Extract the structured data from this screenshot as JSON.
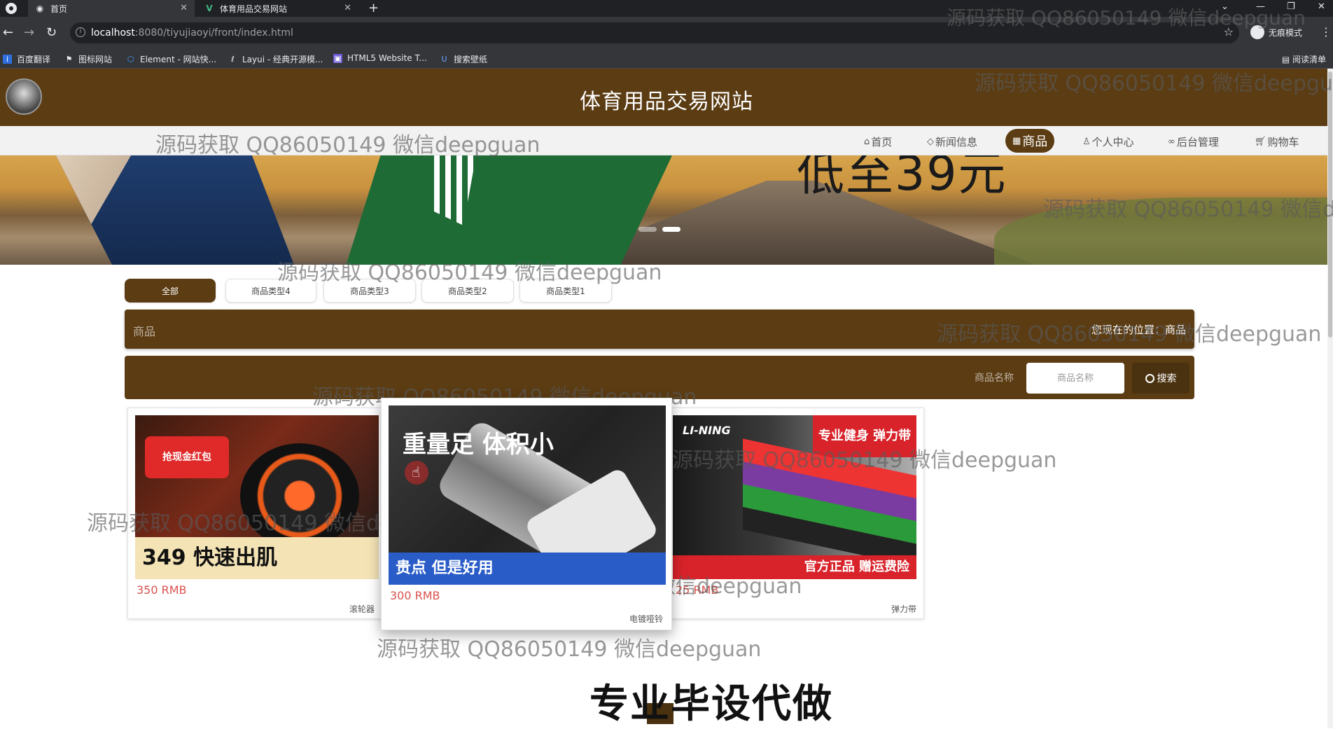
{
  "browser": {
    "tabs": [
      {
        "title": "首页",
        "active": true
      },
      {
        "title": "体育用品交易网站",
        "active": false
      }
    ],
    "url_host": "localhost",
    "url_path": ":8080/tiyujiaoyi/front/index.html",
    "profile_label": "无痕模式",
    "bookmarks": [
      "百度翻译",
      "图标网站",
      "Element - 网站快...",
      "Layui - 经典开源模...",
      "HTML5 Website T...",
      "搜索壁纸"
    ],
    "reading_list": "阅读清单"
  },
  "site": {
    "title": "体育用品交易网站",
    "nav": [
      {
        "label": "首页",
        "icon": "home-icon"
      },
      {
        "label": "新闻信息",
        "icon": "tag-icon"
      },
      {
        "label": "商品",
        "icon": "grid-icon",
        "active": true
      },
      {
        "label": "个人中心",
        "icon": "user-icon"
      },
      {
        "label": "后台管理",
        "icon": "link-icon"
      },
      {
        "label": "购物车",
        "icon": "cart-icon"
      }
    ],
    "banner_text": "低至39元",
    "banner_slide": {
      "count": 2,
      "active": 2
    }
  },
  "filters": [
    "全部",
    "商品类型4",
    "商品类型3",
    "商品类型2",
    "商品类型1"
  ],
  "crumb": {
    "title": "商品",
    "location": "您现在的位置：商品"
  },
  "search": {
    "label": "商品名称",
    "placeholder": "商品名称",
    "button": "搜索"
  },
  "products": [
    {
      "price": "350 RMB",
      "name": "滚轮器",
      "img_badge": "抢现金红包",
      "img_price": "349 快速出肌"
    },
    {
      "price": "300 RMB",
      "name": "电镀哑铃",
      "img_headline": "重量足 体积小",
      "img_footer": "贵点 但是好用"
    },
    {
      "price": "25 RMB",
      "name": "弹力带",
      "img_logo": "LI-NING",
      "img_top": "专业健身 弹力带",
      "img_footer": "官方正品 赠运费险"
    }
  ],
  "watermark": "源码获取 QQ86050149 微信deepguan",
  "bottom_text": "专业毕设代做"
}
